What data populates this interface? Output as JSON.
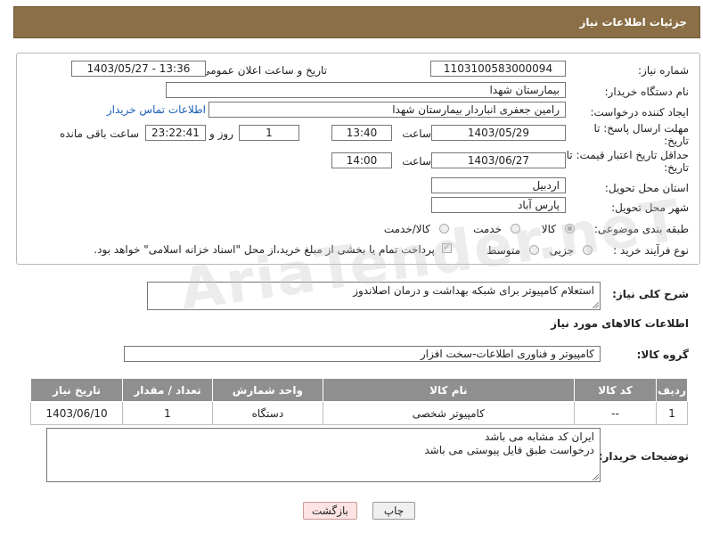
{
  "header": {
    "title": "جزئیات اطلاعات نیاز"
  },
  "form": {
    "need_number": {
      "label": "شماره نیاز:",
      "value": "1103100583000094"
    },
    "announce_datetime": {
      "label": "تاریخ و ساعت اعلان عمومی:",
      "value": "1403/05/27 - 13:36"
    },
    "buyer_org": {
      "label": "نام دستگاه خریدار:",
      "value": "بیمارستان شهدا"
    },
    "creator": {
      "label": "ایجاد کننده درخواست:",
      "value": "رامین جعفری انباردار بیمارستان شهدا",
      "contact_link": "اطلاعات تماس خریدار"
    },
    "reply_deadline": {
      "label_line1": "مهلت ارسال پاسخ: تا",
      "label_line2": "تاریخ:",
      "date": "1403/05/29",
      "time_label": "ساعت",
      "time": "13:40",
      "days": "1",
      "days_label": "روز و",
      "remaining": "23:22:41",
      "remaining_label": "ساعت باقی مانده"
    },
    "price_validity": {
      "label_line1": "حداقل تاریخ اعتبار قیمت: تا",
      "label_line2": "تاریخ:",
      "date": "1403/06/27",
      "time_label": "ساعت",
      "time": "14:00"
    },
    "province": {
      "label": "استان محل تحویل:",
      "value": "اردبیل"
    },
    "city": {
      "label": "شهر محل تحویل:",
      "value": "پارس آباد"
    },
    "category": {
      "label": "طبقه بندی موضوعی:",
      "options": [
        "کالا",
        "خدمت",
        "کالا/خدمت"
      ],
      "selected": "کالا"
    },
    "process_type": {
      "label": "نوع فرآیند خرید :",
      "options": [
        "جزیی",
        "متوسط"
      ],
      "note": "پرداخت تمام یا بخشی از مبلغ خرید،از محل \"اسناد خزانه اسلامی\" خواهد بود."
    }
  },
  "summary": {
    "label": "شرح کلی نیاز:",
    "value": "استعلام کامپیوتر برای شبکه بهداشت و درمان اصلاندوز"
  },
  "goods_section": {
    "title": "اطلاعات کالاهای مورد نیاز"
  },
  "goods_group": {
    "label": "گروه کالا:",
    "value": "کامپیوتر و فناوری اطلاعات-سخت افزار"
  },
  "table": {
    "headers": [
      "ردیف",
      "کد کالا",
      "نام کالا",
      "واحد شمارش",
      "تعداد / مقدار",
      "تاریخ نیاز"
    ],
    "rows": [
      {
        "row": "1",
        "code": "--",
        "name": "کامپیوتر شخصی",
        "unit": "دستگاه",
        "qty": "1",
        "date": "1403/06/10"
      }
    ]
  },
  "buyer_notes": {
    "label": "توضیحات خریدار:",
    "line1": "ایران کد مشابه می باشد",
    "line2": "درخواست طبق فایل پیوستی می باشد"
  },
  "buttons": {
    "print": "چاپ",
    "back": "بازگشت"
  },
  "watermark": "AriaTender.neT"
}
